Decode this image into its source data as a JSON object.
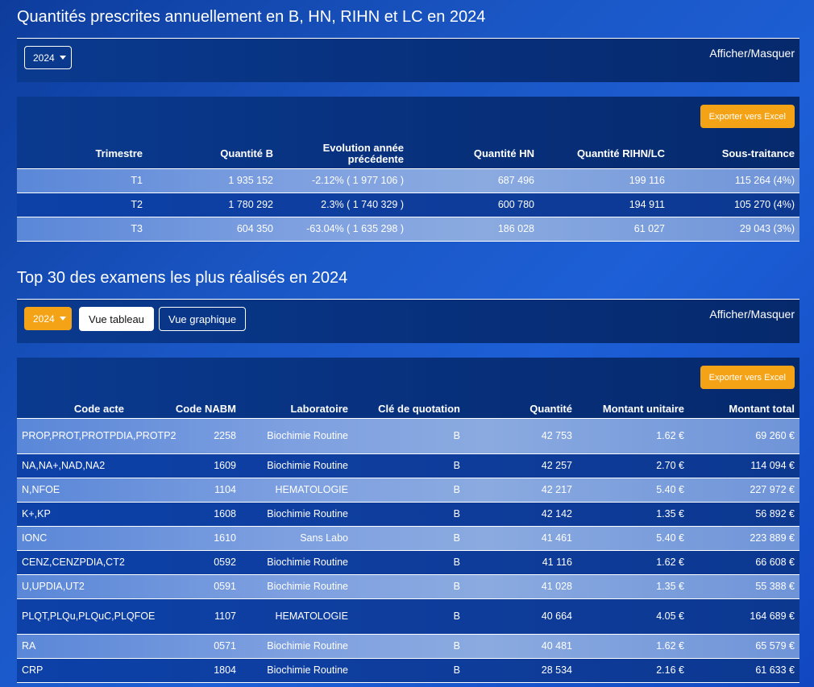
{
  "section1": {
    "title": "Quantités prescrites annuellement en B, HN, RIHN et LC en 2024",
    "year": "2024",
    "toggle_label": "Afficher/Masquer",
    "export_label": "Exporter vers Excel",
    "columns": [
      "Trimestre",
      "Quantité B",
      "Evolution année précédente",
      "Quantité HN",
      "Quantité RIHN/LC",
      "Sous-traitance"
    ],
    "rows": [
      [
        "T1",
        "1 935 152",
        "-2.12% ( 1 977 106 )",
        "687 496",
        "199 116",
        "115 264 (4%)"
      ],
      [
        "T2",
        "1 780 292",
        "2.3% ( 1 740 329 )",
        "600 780",
        "194 911",
        "105 270 (4%)"
      ],
      [
        "T3",
        "604 350",
        "-63.04% ( 1 635 298 )",
        "186 028",
        "61 027",
        "29 043 (3%)"
      ]
    ]
  },
  "section2": {
    "title": "Top 30 des examens les plus réalisés en 2024",
    "year": "2024",
    "view_table_label": "Vue tableau",
    "view_chart_label": "Vue graphique",
    "toggle_label": "Afficher/Masquer",
    "export_label": "Exporter vers Excel",
    "columns": [
      "Code acte",
      "Code NABM",
      "Laboratoire",
      "Clé de quotation",
      "Quantité",
      "Montant unitaire",
      "Montant total"
    ],
    "rows": [
      [
        "PROP,PROT,PROTPDIA,PROTP2",
        "2258",
        "Biochimie Routine",
        "B",
        "42 753",
        "1.62 €",
        "69 260 €"
      ],
      [
        "NA,NA+,NAD,NA2",
        "1609",
        "Biochimie Routine",
        "B",
        "42 257",
        "2.70 €",
        "114 094 €"
      ],
      [
        "N,NFOE",
        "1104",
        "HEMATOLOGIE",
        "B",
        "42 217",
        "5.40 €",
        "227 972 €"
      ],
      [
        "K+,KP",
        "1608",
        "Biochimie Routine",
        "B",
        "42 142",
        "1.35 €",
        "56 892 €"
      ],
      [
        "IONC",
        "1610",
        "Sans Labo",
        "B",
        "41 461",
        "5.40 €",
        "223 889 €"
      ],
      [
        "CENZ,CENZPDIA,CT2",
        "0592",
        "Biochimie Routine",
        "B",
        "41 116",
        "1.62 €",
        "66 608 €"
      ],
      [
        "U,UPDIA,UT2",
        "0591",
        "Biochimie Routine",
        "B",
        "41 028",
        "1.35 €",
        "55 388 €"
      ],
      [
        "PLQT,PLQu,PLQuC,PLQFOE",
        "1107",
        "HEMATOLOGIE",
        "B",
        "40 664",
        "4.05 €",
        "164 689 €"
      ],
      [
        "RA",
        "0571",
        "Biochimie Routine",
        "B",
        "40 481",
        "1.62 €",
        "65 579 €"
      ],
      [
        "CRP",
        "1804",
        "Biochimie Routine",
        "B",
        "28 534",
        "2.16 €",
        "61 633 €"
      ]
    ]
  }
}
